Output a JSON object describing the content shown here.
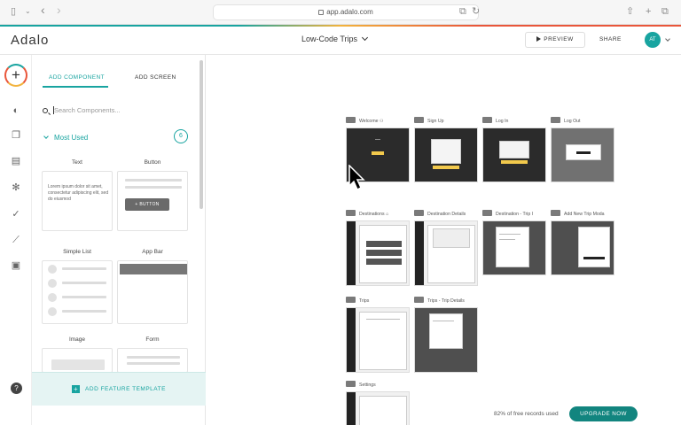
{
  "browser": {
    "url": "app.adalo.com",
    "nav_back": "‹",
    "nav_forward": "›"
  },
  "header": {
    "logo": "Adalo",
    "project": "Low-Code Trips",
    "preview": "PREVIEW",
    "share": "SHARE",
    "avatar": "AT",
    "accent_colors": [
      "#18a4a0",
      "#f2b33d",
      "#e9563a"
    ]
  },
  "rail": {
    "add_icon": "plus-icon",
    "icons": [
      "palette-icon",
      "screens-icon",
      "database-icon",
      "settings-icon",
      "publish-icon",
      "analytics-icon",
      "archive-icon"
    ],
    "help": "?"
  },
  "panel": {
    "tabs": [
      "ADD COMPONENT",
      "ADD SCREEN"
    ],
    "search_placeholder": "Search Components...",
    "section": "Most Used",
    "section_count": "6",
    "components": [
      {
        "label": "Text",
        "sample": "Lorem ipsum dolor sit amet, consectetur adipiscing elit, sed do eiusmod"
      },
      {
        "label": "Button",
        "sample": "+ BUTTON"
      },
      {
        "label": "Simple List"
      },
      {
        "label": "App Bar"
      },
      {
        "label": "Image"
      },
      {
        "label": "Form"
      }
    ],
    "feature_template": "ADD FEATURE TEMPLATE"
  },
  "canvas": {
    "screens": [
      {
        "name": "Welcome",
        "style": "dark"
      },
      {
        "name": "Sign Up",
        "style": "dark"
      },
      {
        "name": "Log In",
        "style": "dark"
      },
      {
        "name": "Log Out",
        "style": "gray"
      },
      {
        "name": "Destinations",
        "style": "light"
      },
      {
        "name": "Destination Details",
        "style": "light"
      },
      {
        "name": "Destination - Trip I",
        "style": "mid"
      },
      {
        "name": "Add New Trip Moda",
        "style": "mid"
      },
      {
        "name": "Trips",
        "style": "light"
      },
      {
        "name": "Trips - Trip Details",
        "style": "mid"
      },
      {
        "name": "Settings",
        "style": "light"
      }
    ]
  },
  "footer": {
    "records": "82% of free records used",
    "upgrade": "UPGRADE NOW"
  }
}
